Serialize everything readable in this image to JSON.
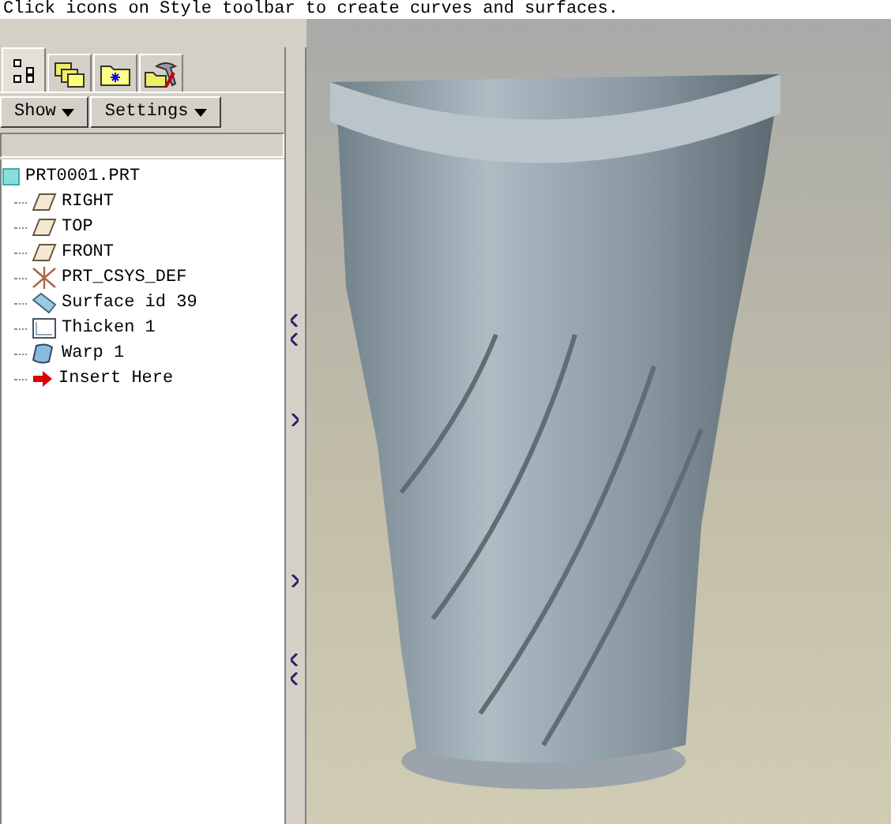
{
  "message": "Click icons on Style toolbar to create curves and surfaces.",
  "tabs": [
    {
      "kind": "tree",
      "selected": true
    },
    {
      "kind": "layers",
      "selected": false
    },
    {
      "kind": "folder",
      "selected": false
    },
    {
      "kind": "tools",
      "selected": false
    }
  ],
  "buttons": [
    "Show",
    "Settings"
  ],
  "tree": {
    "label": "PRT0001.PRT",
    "kind": "part",
    "children": [
      {
        "label": "RIGHT",
        "kind": "plane"
      },
      {
        "label": "TOP",
        "kind": "plane"
      },
      {
        "label": "FRONT",
        "kind": "plane"
      },
      {
        "label": "PRT_CSYS_DEF",
        "kind": "csys"
      },
      {
        "label": "Surface id 39",
        "kind": "surface"
      },
      {
        "label": "Thicken 1",
        "kind": "thicken"
      },
      {
        "label": "Warp 1",
        "kind": "warp"
      },
      {
        "label": "Insert Here",
        "kind": "insert"
      }
    ]
  }
}
